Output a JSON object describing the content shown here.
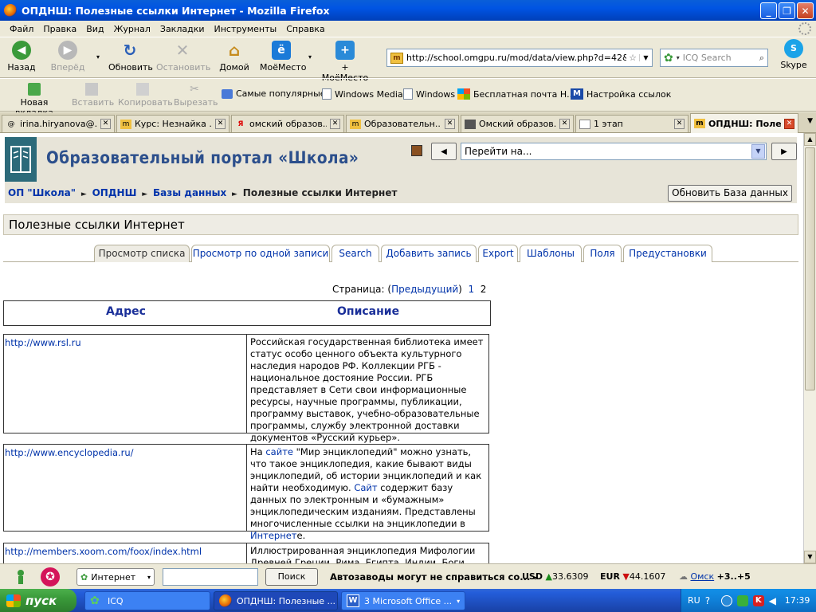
{
  "window": {
    "title": "ОПДНШ: Полезные ссылки Интернет - Mozilla Firefox"
  },
  "menu": [
    "Файл",
    "Правка",
    "Вид",
    "Журнал",
    "Закладки",
    "Инструменты",
    "Справка"
  ],
  "nav": {
    "back": "Назад",
    "forward": "Вперёд",
    "reload": "Обновить",
    "stop": "Остановить",
    "home": "Домой",
    "mymesto": "МоёМесто",
    "add_mymesto": "+ МоёМесто",
    "url": "http://school.omgpu.ru/mod/data/view.php?d=42&ac",
    "search_placeholder": "ICQ Search",
    "skype": "Skype"
  },
  "bookmarks": {
    "new_tab": "Новая вкладка",
    "paste": "Вставить",
    "copy": "Копировать",
    "cut": "Вырезать",
    "links": [
      "Самые популярные",
      "Windows Media",
      "Windows",
      "Бесплатная почта Н...",
      "Настройка ссылок"
    ]
  },
  "tabs": [
    "irina.hiryanova@...",
    "Курс: Незнайка ...",
    "омский образов...",
    "Образовательн...",
    "Омский образов...",
    "1 этап",
    "ОПДНШ: Поле..."
  ],
  "page": {
    "site_title": "Образовательный портал «Школа»",
    "jump_label": "Перейти на...",
    "breadcrumbs": [
      "ОП \"Школа\"",
      "ОПДНШ",
      "Базы данных"
    ],
    "breadcrumb_current": "Полезные ссылки Интернет",
    "edit_button": "Обновить База данных",
    "heading": "Полезные ссылки Интернет",
    "tabs": [
      "Просмотр списка",
      "Просмотр по одной записи",
      "Search",
      "Добавить запись",
      "Export",
      "Шаблоны",
      "Поля",
      "Предустановки"
    ],
    "pager": {
      "label": "Страница:",
      "prev_open": "(",
      "prev": "Предыдущий",
      "prev_close": ")",
      "p1": "1",
      "p2": "2"
    },
    "col_address": "Адрес",
    "col_description": "Описание",
    "entries": [
      {
        "url": "http://www.rsl.ru",
        "desc": "Российская государственная библиотека имеет статус особо ценного объекта культурного наследия народов РФ. Коллекции РГБ - национальное достояние России. РГБ представляет в Сети свои информационные ресурсы, научные программы, публикации, программу выставок, учебно-образовательные программы, службу электронной доставки документов «Русский курьер»."
      },
      {
        "url": "http://www.encyclopedia.ru/",
        "desc_a": "На ",
        "desc_link1": "сайте",
        "desc_b": " \"Мир энциклопедий\" можно узнать, что такое энциклопедия, какие бывают виды энциклопедий, об истории энциклопедий и как найти необходимую. ",
        "desc_link2": "Сайт",
        "desc_c": " содержит базу данных по электронным и «бумажным» энциклопедическим изданиям. Представлены многочисленные ссылки на энциклопедии в ",
        "desc_link3": "Интернет",
        "desc_d": "е."
      },
      {
        "url": "http://members.xoom.com/foox/index.html",
        "desc": "Иллюстрированная энциклопедия Мифологии Древней Греции, Рима, Египта, Индии. Боги, титаны"
      }
    ]
  },
  "icq": {
    "select": "Интернет",
    "search_btn": "Поиск",
    "news": "Автозаводы могут не справиться со...",
    "usd_label": "USD",
    "usd": "33.6309",
    "eur_label": "EUR",
    "eur": "44.1607",
    "city": "Омск",
    "temp": "+3..+5"
  },
  "taskbar": {
    "start": "пуск",
    "items": [
      "ICQ",
      "ОПДНШ: Полезные ...",
      "3 Microsoft Office ..."
    ],
    "lang": "RU",
    "time": "17:39"
  }
}
